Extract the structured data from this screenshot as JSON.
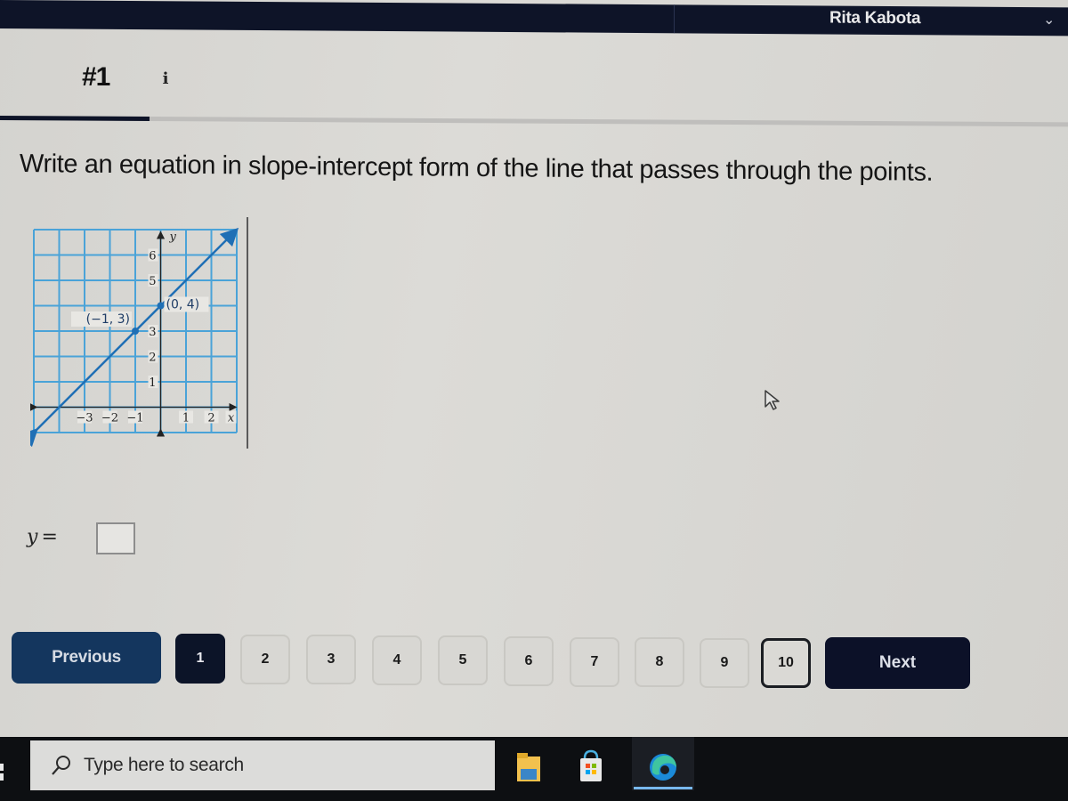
{
  "header": {
    "user_name": "Rita Kabota",
    "user_menu_icon": "chevron-down-icon"
  },
  "question": {
    "number_label": "#1",
    "info_icon": "i",
    "progress_fraction": 0.1,
    "prompt": "Write an equation in slope-intercept form of the line that passes through the points."
  },
  "graph": {
    "x_axis_label": "x",
    "y_axis_label": "y",
    "x_range": [
      -5,
      3
    ],
    "y_range": [
      -1,
      7
    ],
    "x_ticks": [
      {
        "value": -3,
        "label": "−3"
      },
      {
        "value": -2,
        "label": "−2"
      },
      {
        "value": -1,
        "label": "−1"
      },
      {
        "value": 1,
        "label": "1"
      },
      {
        "value": 2,
        "label": "2"
      }
    ],
    "y_ticks": [
      {
        "value": 1,
        "label": "1"
      },
      {
        "value": 2,
        "label": "2"
      },
      {
        "value": 3,
        "label": "3"
      },
      {
        "value": 5,
        "label": "5"
      },
      {
        "value": 6,
        "label": "6"
      }
    ],
    "points": [
      {
        "x": -1,
        "y": 3,
        "label": "(−1, 3)"
      },
      {
        "x": 0,
        "y": 4,
        "label": "(0, 4)"
      }
    ],
    "line": {
      "slope": 1,
      "intercept": 4
    },
    "line_color": "#1f6fb5",
    "grid_color": "#4aa3d8"
  },
  "answer": {
    "prefix": "y",
    "equals": "=",
    "value": ""
  },
  "navigation": {
    "previous_label": "Previous",
    "next_label": "Next",
    "current_page": 1,
    "pages": [
      "1",
      "2",
      "3",
      "4",
      "5",
      "6",
      "7",
      "8",
      "9",
      "10"
    ]
  },
  "taskbar": {
    "search_placeholder": "Type here to search",
    "apps": [
      "file-explorer",
      "microsoft-store",
      "microsoft-edge"
    ]
  }
}
